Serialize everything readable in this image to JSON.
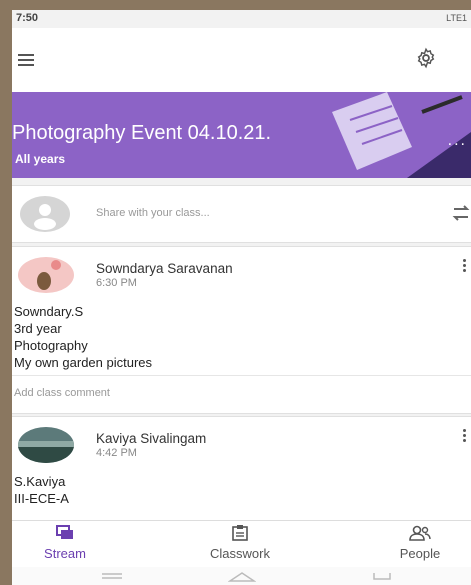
{
  "status": {
    "time": "7:50",
    "signal_text": "LTE1"
  },
  "class_banner": {
    "title": "Photography Event 04.10.21.",
    "subtitle": "All years",
    "color": "#8c63c6"
  },
  "share": {
    "placeholder": "Share with your class..."
  },
  "posts": [
    {
      "author": "Sowndarya Saravanan",
      "time": "6:30 PM",
      "lines": [
        "Sowndary.S",
        "3rd year",
        "Photography",
        "My own garden pictures"
      ],
      "comment_placeholder": "Add class comment"
    },
    {
      "author": "Kaviya Sivalingam",
      "time": "4:42 PM",
      "lines": [
        "S.Kaviya",
        "III-ECE-A"
      ]
    }
  ],
  "bottom_nav": {
    "items": [
      {
        "label": "Stream",
        "icon": "stream-icon",
        "active": true
      },
      {
        "label": "Classwork",
        "icon": "classwork-icon",
        "active": false
      },
      {
        "label": "People",
        "icon": "people-icon",
        "active": false
      }
    ],
    "active_color": "#6b3fb0"
  }
}
